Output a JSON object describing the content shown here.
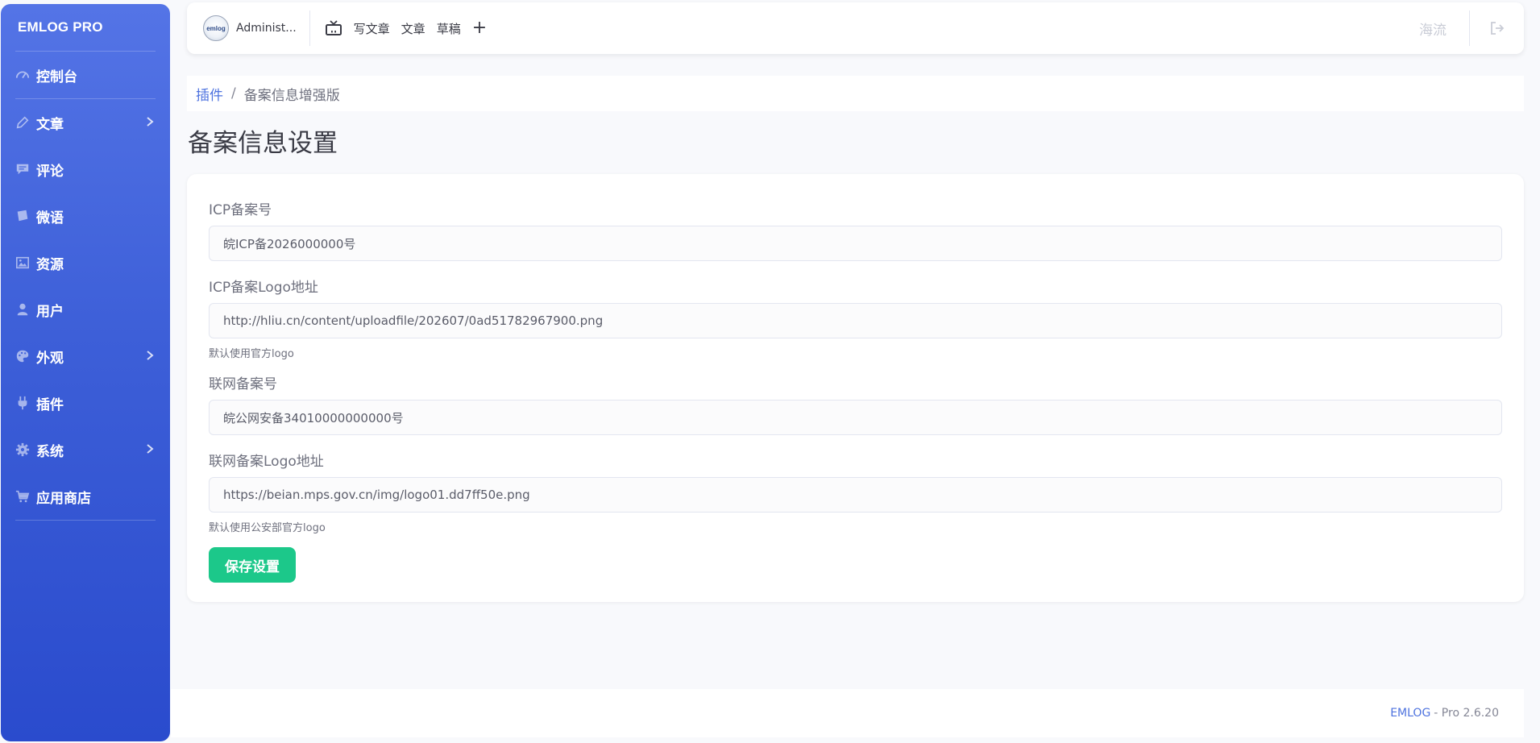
{
  "sidebar": {
    "brand": "EMLOG PRO",
    "items": [
      {
        "label": "控制台",
        "icon": "dashboard-icon"
      },
      {
        "label": "文章",
        "icon": "pencil-icon",
        "has_submenu": true
      },
      {
        "label": "评论",
        "icon": "comment-icon"
      },
      {
        "label": "微语",
        "icon": "note-icon"
      },
      {
        "label": "资源",
        "icon": "image-icon"
      },
      {
        "label": "用户",
        "icon": "user-icon"
      },
      {
        "label": "外观",
        "icon": "palette-icon",
        "has_submenu": true
      },
      {
        "label": "插件",
        "icon": "plug-icon"
      },
      {
        "label": "系统",
        "icon": "gear-icon",
        "has_submenu": true
      },
      {
        "label": "应用商店",
        "icon": "cart-icon"
      }
    ]
  },
  "topbar": {
    "avatar_text": "emlog",
    "username": "Administ...",
    "quick_links": {
      "write": "写文章",
      "articles": "文章",
      "drafts": "草稿",
      "add": "+"
    },
    "site_name": "海流"
  },
  "breadcrumb": {
    "parent": "插件",
    "separator": "/",
    "current": "备案信息增强版"
  },
  "page": {
    "title": "备案信息设置"
  },
  "form": {
    "icp_label": "ICP备案号",
    "icp_value": "皖ICP备2026000000号",
    "icp_logo_label": "ICP备案Logo地址",
    "icp_logo_value": "http://hliu.cn/content/uploadfile/202607/0ad51782967900.png",
    "icp_logo_help": "默认使用官方logo",
    "police_label": "联网备案号",
    "police_value": "皖公网安备34010000000000号",
    "police_logo_label": "联网备案Logo地址",
    "police_logo_value": "https://beian.mps.gov.cn/img/logo01.dd7ff50e.png",
    "police_logo_help": "默认使用公安部官方logo",
    "save_label": "保存设置"
  },
  "footer": {
    "link": "EMLOG",
    "version": "- Pro 2.6.20"
  },
  "colors": {
    "sidebar_top": "#5474e6",
    "sidebar_bottom": "#2a4bcd",
    "primary": "#4e73df",
    "success": "#1cc88a"
  }
}
